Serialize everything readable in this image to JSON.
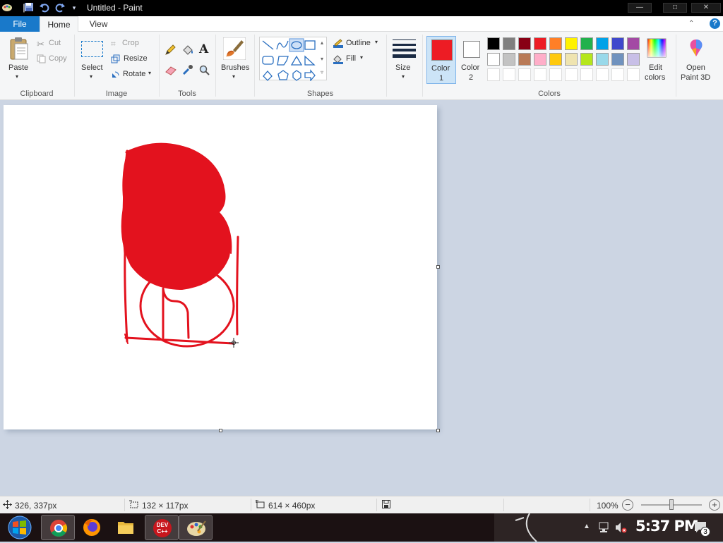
{
  "window": {
    "title": "Untitled - Paint",
    "controls": {
      "minimize": "—",
      "maximize": "□",
      "close": "✕"
    }
  },
  "tabs": {
    "file": "File",
    "home": "Home",
    "view": "View"
  },
  "ribbon": {
    "clipboard": {
      "paste": "Paste",
      "cut": "Cut",
      "copy": "Copy",
      "group": "Clipboard"
    },
    "image": {
      "select": "Select",
      "crop": "Crop",
      "resize": "Resize",
      "rotate": "Rotate",
      "group": "Image"
    },
    "tools": {
      "group": "Tools"
    },
    "brushes": {
      "label": "Brushes"
    },
    "shapes": {
      "outline": "Outline",
      "fill": "Fill",
      "group": "Shapes"
    },
    "size": {
      "label": "Size"
    },
    "colors": {
      "color1_line1": "Color",
      "color1_line2": "1",
      "color2_line1": "Color",
      "color2_line2": "2",
      "color1": "#ed1c24",
      "color2": "#ffffff",
      "edit_line1": "Edit",
      "edit_line2": "colors",
      "group": "Colors",
      "palette_row1": [
        "#000000",
        "#7f7f7f",
        "#880015",
        "#ed1c24",
        "#ff7f27",
        "#fff200",
        "#22b14c",
        "#00a2e8",
        "#3f48cc",
        "#a349a4"
      ],
      "palette_row2": [
        "#ffffff",
        "#c3c3c3",
        "#b97a57",
        "#ffaec9",
        "#ffc90e",
        "#efe4b0",
        "#b5e61d",
        "#99d9ea",
        "#7092be",
        "#c8bfe7"
      ]
    },
    "paint3d": {
      "line1": "Open",
      "line2": "Paint 3D"
    }
  },
  "canvas": {
    "drawing_color": "#e3121e"
  },
  "status": {
    "cursor_pos": "326, 337px",
    "selection_size": "132 × 117px",
    "canvas_size": "614 × 460px",
    "zoom": "100%"
  },
  "taskbar": {
    "time": "5:37 PM",
    "notification_count": "3",
    "apps": [
      "start-button",
      "chrome",
      "firefox",
      "file-explorer",
      "dev-cpp",
      "paint"
    ]
  }
}
